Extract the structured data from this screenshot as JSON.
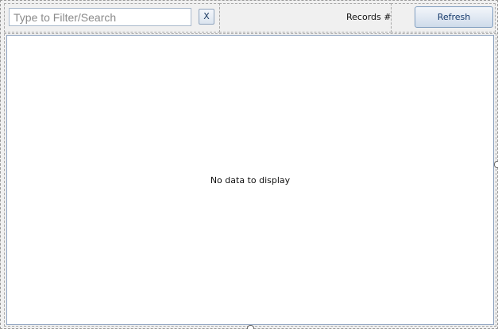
{
  "toolbar": {
    "search": {
      "value": "",
      "placeholder": "Type to Filter/Search"
    },
    "clear_label": "X",
    "records_label": "Records #",
    "refresh_label": "Refresh"
  },
  "grid": {
    "empty_message": "No data to display"
  },
  "colors": {
    "background": "#f0f0f0",
    "grid_border": "#8ea3c0",
    "button_text": "#15396b"
  }
}
